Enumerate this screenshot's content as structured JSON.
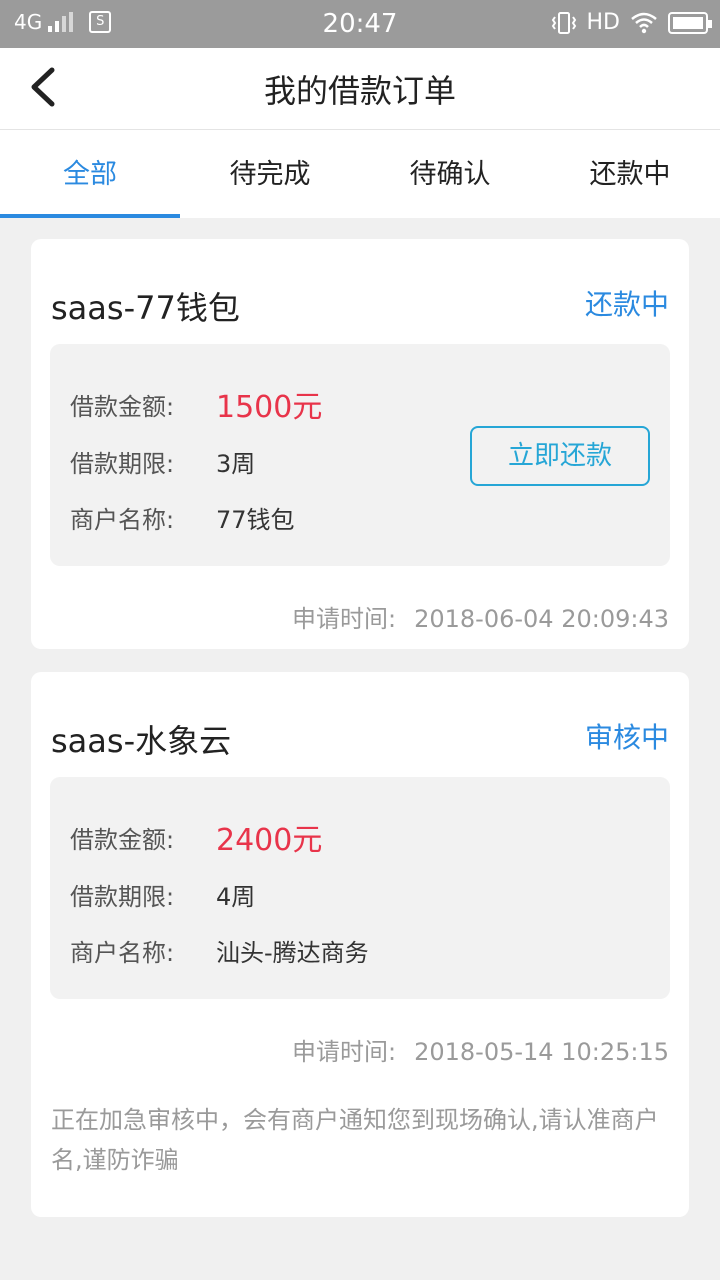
{
  "status_bar": {
    "network": "4G",
    "sim_icon": "S",
    "time": "20:47",
    "hd": "HD",
    "icons": [
      "signal-icon",
      "sim-icon",
      "vibrate-icon",
      "wifi-icon",
      "battery-icon"
    ]
  },
  "header": {
    "title": "我的借款订单",
    "back_icon": "chevron-left-icon"
  },
  "tabs": [
    {
      "label": "全部",
      "active": true
    },
    {
      "label": "待完成",
      "active": false
    },
    {
      "label": "待确认",
      "active": false
    },
    {
      "label": "还款中",
      "active": false
    }
  ],
  "orders": [
    {
      "name": "saas-77钱包",
      "status": "还款中",
      "amount_label": "借款金额:",
      "amount": "1500元",
      "term_label": "借款期限:",
      "term": "3周",
      "merchant_label": "商户名称:",
      "merchant": "77钱包",
      "action": "立即还款",
      "apply_label": "申请时间:",
      "apply_time": "2018-06-04 20:09:43"
    },
    {
      "name": "saas-水象云",
      "status": "审核中",
      "amount_label": "借款金额:",
      "amount": "2400元",
      "term_label": "借款期限:",
      "term": "4周",
      "merchant_label": "商户名称:",
      "merchant": "汕头-腾达商务",
      "apply_label": "申请时间:",
      "apply_time": "2018-05-14 10:25:15",
      "notice": "正在加急审核中，会有商户通知您到现场确认,请认准商户名,谨防诈骗"
    }
  ],
  "colors": {
    "accent": "#2b8ae0",
    "amount": "#e8344a",
    "button": "#26a6d6",
    "statusbar": "#9b9b9b"
  }
}
